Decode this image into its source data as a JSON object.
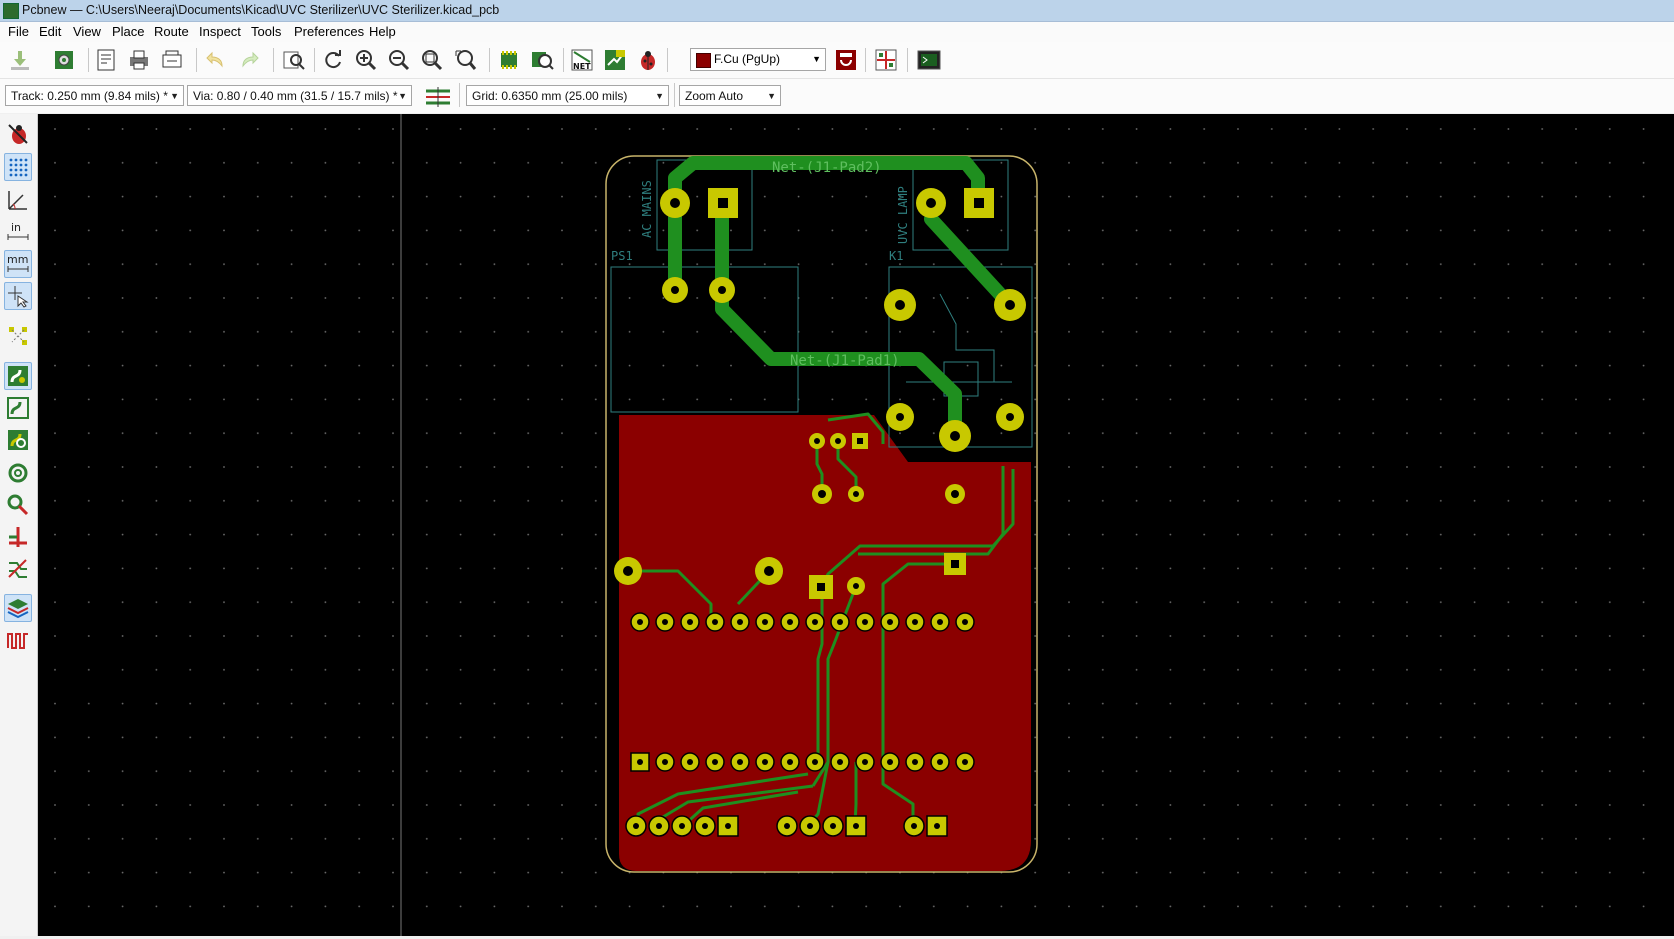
{
  "window": {
    "title": "Pcbnew — C:\\Users\\Neeraj\\Documents\\Kicad\\UVC Sterilizer\\UVC Sterilizer.kicad_pcb"
  },
  "menu": [
    "File",
    "Edit",
    "View",
    "Place",
    "Route",
    "Inspect",
    "Tools",
    "Preferences",
    "Help"
  ],
  "toolbar": {
    "layer_selector": "F.Cu (PgUp)",
    "layer_color": "#8b0000",
    "net_icon_label": "NET"
  },
  "options_bar": {
    "track": "Track: 0.250 mm (9.84 mils) *",
    "via": "Via: 0.80 / 0.40 mm (31.5 / 15.7 mils) *",
    "grid": "Grid: 0.6350 mm (25.00 mils)",
    "zoom": "Zoom Auto"
  },
  "left_toolbar": {
    "units_in_label": "in",
    "units_mm_label": "mm"
  },
  "board": {
    "background": "#000000",
    "copper_color": "#8b0000",
    "track_color": "#1f8f1f",
    "pad_color": "#c8c800",
    "silk_color": "#2f7f7f",
    "net_label_top": "Net-(J1-Pad2)",
    "net_label_mid": "Net-(J1-Pad1)",
    "ref_ps1": "PS1",
    "ref_k1": "K1",
    "value_ac": "AC MAINS",
    "value_uvc": "UVC LAMP"
  }
}
